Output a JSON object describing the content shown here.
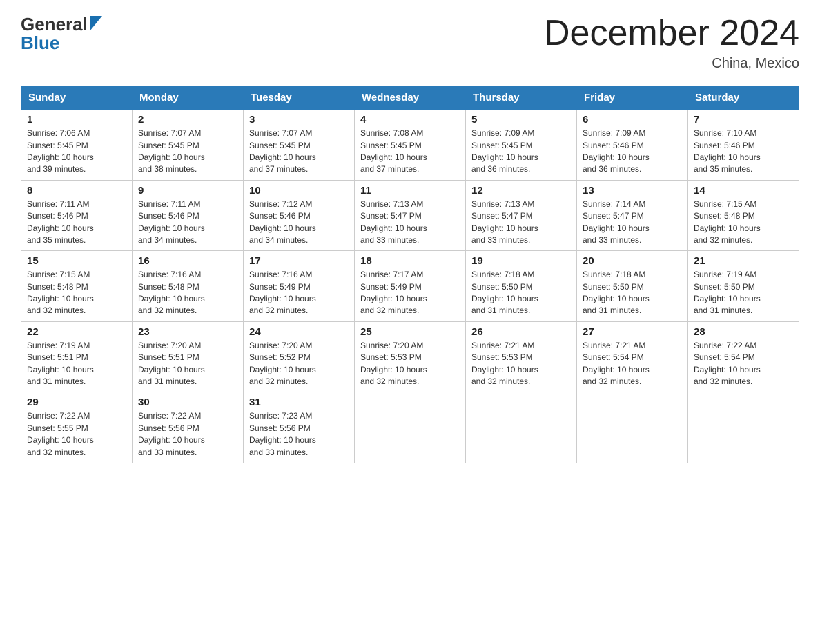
{
  "header": {
    "logo_line1": "General",
    "logo_line2": "Blue",
    "month_title": "December 2024",
    "location": "China, Mexico"
  },
  "weekdays": [
    "Sunday",
    "Monday",
    "Tuesday",
    "Wednesday",
    "Thursday",
    "Friday",
    "Saturday"
  ],
  "weeks": [
    [
      {
        "day": "1",
        "info": "Sunrise: 7:06 AM\nSunset: 5:45 PM\nDaylight: 10 hours\nand 39 minutes."
      },
      {
        "day": "2",
        "info": "Sunrise: 7:07 AM\nSunset: 5:45 PM\nDaylight: 10 hours\nand 38 minutes."
      },
      {
        "day": "3",
        "info": "Sunrise: 7:07 AM\nSunset: 5:45 PM\nDaylight: 10 hours\nand 37 minutes."
      },
      {
        "day": "4",
        "info": "Sunrise: 7:08 AM\nSunset: 5:45 PM\nDaylight: 10 hours\nand 37 minutes."
      },
      {
        "day": "5",
        "info": "Sunrise: 7:09 AM\nSunset: 5:45 PM\nDaylight: 10 hours\nand 36 minutes."
      },
      {
        "day": "6",
        "info": "Sunrise: 7:09 AM\nSunset: 5:46 PM\nDaylight: 10 hours\nand 36 minutes."
      },
      {
        "day": "7",
        "info": "Sunrise: 7:10 AM\nSunset: 5:46 PM\nDaylight: 10 hours\nand 35 minutes."
      }
    ],
    [
      {
        "day": "8",
        "info": "Sunrise: 7:11 AM\nSunset: 5:46 PM\nDaylight: 10 hours\nand 35 minutes."
      },
      {
        "day": "9",
        "info": "Sunrise: 7:11 AM\nSunset: 5:46 PM\nDaylight: 10 hours\nand 34 minutes."
      },
      {
        "day": "10",
        "info": "Sunrise: 7:12 AM\nSunset: 5:46 PM\nDaylight: 10 hours\nand 34 minutes."
      },
      {
        "day": "11",
        "info": "Sunrise: 7:13 AM\nSunset: 5:47 PM\nDaylight: 10 hours\nand 33 minutes."
      },
      {
        "day": "12",
        "info": "Sunrise: 7:13 AM\nSunset: 5:47 PM\nDaylight: 10 hours\nand 33 minutes."
      },
      {
        "day": "13",
        "info": "Sunrise: 7:14 AM\nSunset: 5:47 PM\nDaylight: 10 hours\nand 33 minutes."
      },
      {
        "day": "14",
        "info": "Sunrise: 7:15 AM\nSunset: 5:48 PM\nDaylight: 10 hours\nand 32 minutes."
      }
    ],
    [
      {
        "day": "15",
        "info": "Sunrise: 7:15 AM\nSunset: 5:48 PM\nDaylight: 10 hours\nand 32 minutes."
      },
      {
        "day": "16",
        "info": "Sunrise: 7:16 AM\nSunset: 5:48 PM\nDaylight: 10 hours\nand 32 minutes."
      },
      {
        "day": "17",
        "info": "Sunrise: 7:16 AM\nSunset: 5:49 PM\nDaylight: 10 hours\nand 32 minutes."
      },
      {
        "day": "18",
        "info": "Sunrise: 7:17 AM\nSunset: 5:49 PM\nDaylight: 10 hours\nand 32 minutes."
      },
      {
        "day": "19",
        "info": "Sunrise: 7:18 AM\nSunset: 5:50 PM\nDaylight: 10 hours\nand 31 minutes."
      },
      {
        "day": "20",
        "info": "Sunrise: 7:18 AM\nSunset: 5:50 PM\nDaylight: 10 hours\nand 31 minutes."
      },
      {
        "day": "21",
        "info": "Sunrise: 7:19 AM\nSunset: 5:50 PM\nDaylight: 10 hours\nand 31 minutes."
      }
    ],
    [
      {
        "day": "22",
        "info": "Sunrise: 7:19 AM\nSunset: 5:51 PM\nDaylight: 10 hours\nand 31 minutes."
      },
      {
        "day": "23",
        "info": "Sunrise: 7:20 AM\nSunset: 5:51 PM\nDaylight: 10 hours\nand 31 minutes."
      },
      {
        "day": "24",
        "info": "Sunrise: 7:20 AM\nSunset: 5:52 PM\nDaylight: 10 hours\nand 32 minutes."
      },
      {
        "day": "25",
        "info": "Sunrise: 7:20 AM\nSunset: 5:53 PM\nDaylight: 10 hours\nand 32 minutes."
      },
      {
        "day": "26",
        "info": "Sunrise: 7:21 AM\nSunset: 5:53 PM\nDaylight: 10 hours\nand 32 minutes."
      },
      {
        "day": "27",
        "info": "Sunrise: 7:21 AM\nSunset: 5:54 PM\nDaylight: 10 hours\nand 32 minutes."
      },
      {
        "day": "28",
        "info": "Sunrise: 7:22 AM\nSunset: 5:54 PM\nDaylight: 10 hours\nand 32 minutes."
      }
    ],
    [
      {
        "day": "29",
        "info": "Sunrise: 7:22 AM\nSunset: 5:55 PM\nDaylight: 10 hours\nand 32 minutes."
      },
      {
        "day": "30",
        "info": "Sunrise: 7:22 AM\nSunset: 5:56 PM\nDaylight: 10 hours\nand 33 minutes."
      },
      {
        "day": "31",
        "info": "Sunrise: 7:23 AM\nSunset: 5:56 PM\nDaylight: 10 hours\nand 33 minutes."
      },
      null,
      null,
      null,
      null
    ]
  ]
}
